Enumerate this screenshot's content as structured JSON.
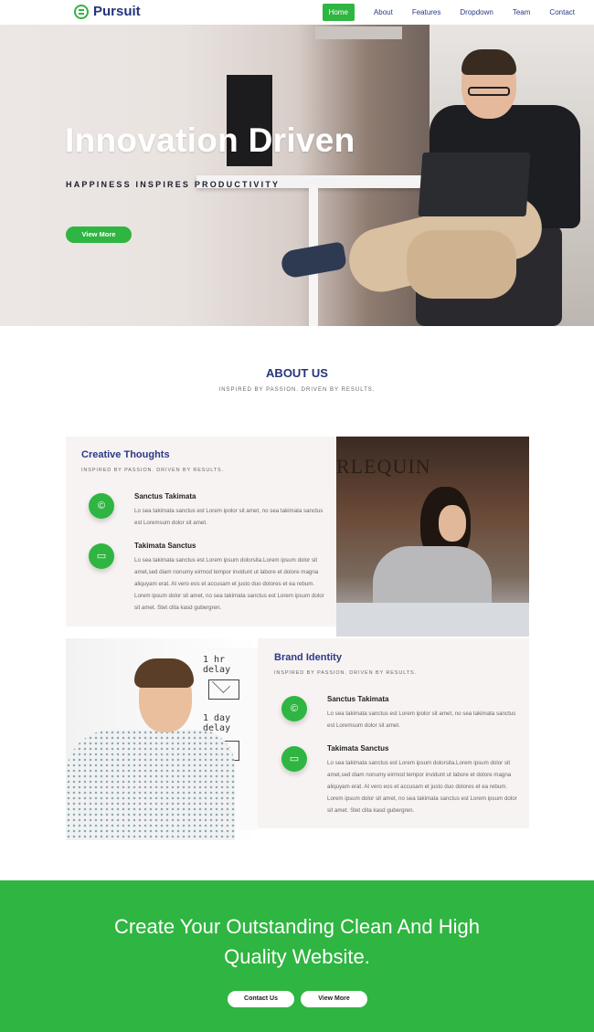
{
  "nav": {
    "brand": "Pursuit",
    "items": [
      {
        "label": "Home",
        "active": true
      },
      {
        "label": "About",
        "active": false
      },
      {
        "label": "Features",
        "active": false
      },
      {
        "label": "Dropdown",
        "active": false
      },
      {
        "label": "Team",
        "active": false
      },
      {
        "label": "Contact",
        "active": false
      }
    ]
  },
  "hero": {
    "title": "Innovation Driven",
    "subtitle": "HAPPINESS INSPIRES PRODUCTIVITY",
    "button": "View More"
  },
  "about": {
    "title": "ABOUT US",
    "subtitle": "INSPIRED BY PASSION. DRIVEN BY RESULTS."
  },
  "card1": {
    "title": "Creative Thoughts",
    "subtitle": "INSPIRED BY PASSION. DRIVEN BY RESULTS.",
    "features": [
      {
        "icon": "copyright-icon",
        "title": "Sanctus Takimata",
        "text": "Lo sea takimata sanctus est Lorem ipolor sit amet, no sea takimata sanctus est Loremsum dolor sit amet."
      },
      {
        "icon": "laptop-icon",
        "title": "Takimata Sanctus",
        "text": "Lo sea takimata sanctus est Lorem ipsum dolorsita.Lorem ipsum dolor sit amet,sed diam nonumy eirmod tempor invidunt ut labore et dolore magna aliquyam erat. At vero eos et accusam et justo duo dolores et ea rebum. Lorem ipsum dolor sit amet, no sea takimata sanctus est Lorem ipsum dolor sit amet. Stet clita kasd gubergren."
      }
    ],
    "photo_sign": "RLEQUIN"
  },
  "card2": {
    "title": "Brand Identity",
    "subtitle": "INSPIRED BY PASSION. DRIVEN BY RESULTS.",
    "features": [
      {
        "icon": "copyright-icon",
        "title": "Sanctus Takimata",
        "text": "Lo sea takimata sanctus est Lorem ipolor sit amet, no sea takimata sanctus est Loremsum dolor sit amet."
      },
      {
        "icon": "laptop-icon",
        "title": "Takimata Sanctus",
        "text": "Lo sea takimata sanctus est Lorem ipsum dolorsita.Lorem ipsum dolor sit amet,sed diam nonumy eirmod tempor invidunt ut labore et dolore magna aliquyam erat. At vero eos et accusam et justo duo dolores et ea rebum. Lorem ipsum dolor sit amet, no sea takimata sanctus est Lorem ipsum dolor sit amet. Stet clita kasd gubergren."
      }
    ],
    "board_text": [
      "1 hr delay",
      "1 day delay"
    ]
  },
  "cta": {
    "title_line1": "Create Your Outstanding Clean And High",
    "title_line2": "Quality Website.",
    "buttons": [
      "Contact Us",
      "View More"
    ]
  },
  "colors": {
    "accent": "#2fb541",
    "navy": "#24357a"
  }
}
